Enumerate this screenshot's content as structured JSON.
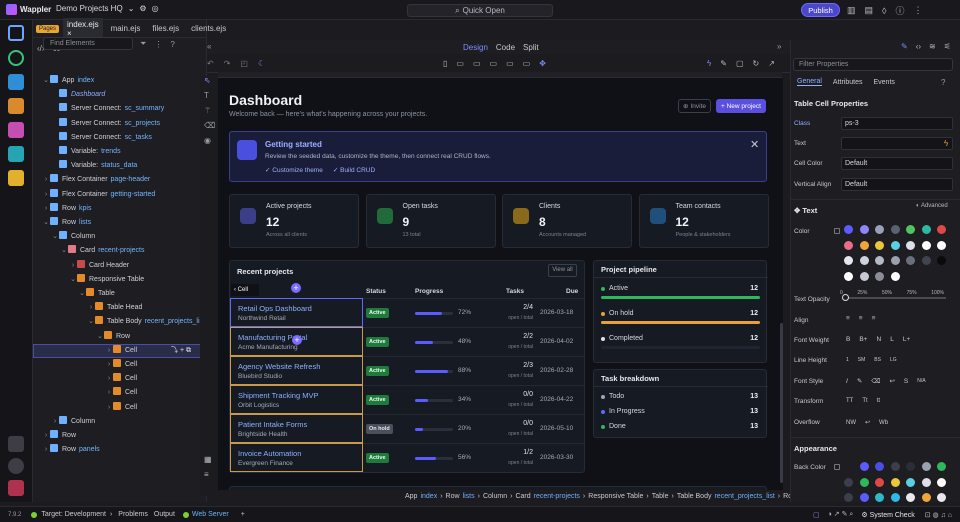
{
  "app": {
    "name": "Wappler",
    "project": "Demo Projects HQ",
    "quick_open": "Quick Open",
    "publish": "Publish"
  },
  "tabs": {
    "pages_badge": "Pages",
    "files": [
      "index.ejs",
      "main.ejs",
      "files.ejs",
      "clients.ejs"
    ]
  },
  "left": {
    "find_placeholder": "Find Elements",
    "tree": [
      {
        "label": "App",
        "sub": "index"
      },
      {
        "label": "Dashboard",
        "sub": ""
      },
      {
        "label": "Server Connect:",
        "sub": "sc_summary"
      },
      {
        "label": "Server Connect:",
        "sub": "sc_projects"
      },
      {
        "label": "Server Connect:",
        "sub": "sc_tasks"
      },
      {
        "label": "Variable:",
        "sub": "trends"
      },
      {
        "label": "Variable:",
        "sub": "status_data"
      },
      {
        "label": "Flex Container",
        "sub": "page-header"
      },
      {
        "label": "Flex Container",
        "sub": "getting-started"
      },
      {
        "label": "Row",
        "sub": "kpis"
      },
      {
        "label": "Row",
        "sub": "lists"
      },
      {
        "label": "Column",
        "sub": ""
      },
      {
        "label": "Card",
        "sub": "recent-projects"
      },
      {
        "label": "Card Header",
        "sub": ""
      },
      {
        "label": "Responsive Table",
        "sub": ""
      },
      {
        "label": "Table",
        "sub": ""
      },
      {
        "label": "Table Head",
        "sub": ""
      },
      {
        "label": "Table Body",
        "sub": "recent_projects_list"
      },
      {
        "label": "Row",
        "sub": ""
      },
      {
        "label": "Cell",
        "sub": ""
      },
      {
        "label": "Cell",
        "sub": ""
      },
      {
        "label": "Cell",
        "sub": ""
      },
      {
        "label": "Cell",
        "sub": ""
      },
      {
        "label": "Cell",
        "sub": ""
      },
      {
        "label": "Column",
        "sub": ""
      },
      {
        "label": "Row",
        "sub": ""
      },
      {
        "label": "Row",
        "sub": "panels"
      }
    ]
  },
  "view_tabs": [
    "Design",
    "Code",
    "Split"
  ],
  "dashboard": {
    "title": "Dashboard",
    "subtitle": "Welcome back — here's what's happening across your projects.",
    "invite": "Invite",
    "new_project": "+ New project",
    "getting_started": {
      "title": "Getting started",
      "text": "Review the seeded data, customize the theme, then connect real CRUD flows.",
      "link1": "Customize theme",
      "link2": "Build CRUD"
    },
    "stats": [
      {
        "title": "Active projects",
        "value": "12",
        "sub": "Across all clients",
        "color": "#3b3f8a"
      },
      {
        "title": "Open tasks",
        "value": "9",
        "sub": "13 total",
        "color": "#1f6b3a"
      },
      {
        "title": "Clients",
        "value": "8",
        "sub": "Accounts managed",
        "color": "#8a6a1a"
      },
      {
        "title": "Team contacts",
        "value": "12",
        "sub": "People & stakeholders",
        "color": "#1f4f7a"
      }
    ],
    "recent": {
      "title": "Recent projects",
      "view_all": "View all",
      "cell_tag": "Cell",
      "headers": [
        "Status",
        "Progress",
        "Tasks",
        "Due"
      ],
      "rows": [
        {
          "name": "Retail Ops Dashboard",
          "client": "Northwind Retail",
          "status": "Active",
          "progress": 72,
          "pct": "72%",
          "tasks": "2/4",
          "sub": "open / total",
          "due": "2026-03-18"
        },
        {
          "name": "Manufacturing Portal",
          "client": "Acme Manufacturing",
          "status": "Active",
          "progress": 48,
          "pct": "48%",
          "tasks": "2/2",
          "sub": "open / total",
          "due": "2026-04-02"
        },
        {
          "name": "Agency Website Refresh",
          "client": "Bluebird Studio",
          "status": "Active",
          "progress": 88,
          "pct": "88%",
          "tasks": "2/3",
          "sub": "open / total",
          "due": "2026-02-28"
        },
        {
          "name": "Shipment Tracking MVP",
          "client": "Orbit Logistics",
          "status": "Active",
          "progress": 34,
          "pct": "34%",
          "tasks": "0/0",
          "sub": "open / total",
          "due": "2026-04-22"
        },
        {
          "name": "Patient Intake Forms",
          "client": "Brightside Health",
          "status": "On hold",
          "progress": 20,
          "pct": "20%",
          "tasks": "0/0",
          "sub": "open / total",
          "due": "2026-05-10"
        },
        {
          "name": "Invoice Automation",
          "client": "Evergreen Finance",
          "status": "Active",
          "progress": 56,
          "pct": "56%",
          "tasks": "1/2",
          "sub": "open / total",
          "due": "2026-03-30"
        }
      ]
    },
    "pipeline": {
      "title": "Project pipeline",
      "items": [
        {
          "label": "Active",
          "value": "12",
          "fill": 1.0,
          "color": "#2fb85a"
        },
        {
          "label": "On hold",
          "value": "12",
          "fill": 1.0,
          "color": "#e8a13a"
        },
        {
          "label": "Completed",
          "value": "12",
          "fill": 0.0,
          "color": "#1f2430"
        }
      ]
    },
    "breakdown": {
      "title": "Task breakdown",
      "items": [
        {
          "label": "Todo",
          "value": "13"
        },
        {
          "label": "In Progress",
          "value": "13"
        },
        {
          "label": "Done",
          "value": "13"
        }
      ]
    }
  },
  "right": {
    "filter_placeholder": "Filter Properties",
    "tabs": [
      "General",
      "Attributes",
      "Events"
    ],
    "section": "Table Cell Properties",
    "class_label": "Class",
    "class_value": "ps-3",
    "text_label": "Text",
    "cell_color_label": "Cell Color",
    "cell_color_value": "Default",
    "valign_label": "Vertical Align",
    "valign_value": "Default",
    "text_section": "Text",
    "advanced": "Advanced",
    "color_label": "Color",
    "opacity_label": "Text Opacity",
    "opacity_ticks": [
      "0",
      "25%",
      "50%",
      "75%",
      "100%"
    ],
    "align_label": "Align",
    "weight_label": "Font Weight",
    "weight_opts": [
      "B",
      "B+",
      "N",
      "L",
      "L+"
    ],
    "lh_label": "Line Height",
    "lh_opts": [
      "1",
      "SM",
      "BS",
      "LG"
    ],
    "style_label": "Font Style",
    "style_na": "N/A",
    "transform_label": "Transform",
    "transform_opts": [
      "TT",
      "Tt",
      "tt"
    ],
    "overflow_label": "Overflow",
    "overflow_opts": [
      "NW",
      "Wb"
    ],
    "appearance": "Appearance",
    "back_color_label": "Back Color"
  },
  "breadcrumb": [
    {
      "t": "App",
      "a": "index"
    },
    {
      "t": "Row",
      "a": "lists"
    },
    {
      "t": "Column",
      "a": ""
    },
    {
      "t": "Card",
      "a": "recent-projects"
    },
    {
      "t": "Responsive Table",
      "a": ""
    },
    {
      "t": "Table",
      "a": ""
    },
    {
      "t": "Table Body",
      "a": "recent_projects_list"
    },
    {
      "t": "Row",
      "a": ""
    },
    {
      "t": "Cell",
      "a": ""
    }
  ],
  "status": {
    "version": "7.9.2",
    "target": "Target: Development",
    "problems": "Problems",
    "output": "Output",
    "web_server": "Web Server",
    "system_check": "System Check"
  },
  "colors": {
    "accent": "#5b5bff",
    "active_badge": "#2fb85a",
    "onhold_badge": "#4a4f5c"
  }
}
